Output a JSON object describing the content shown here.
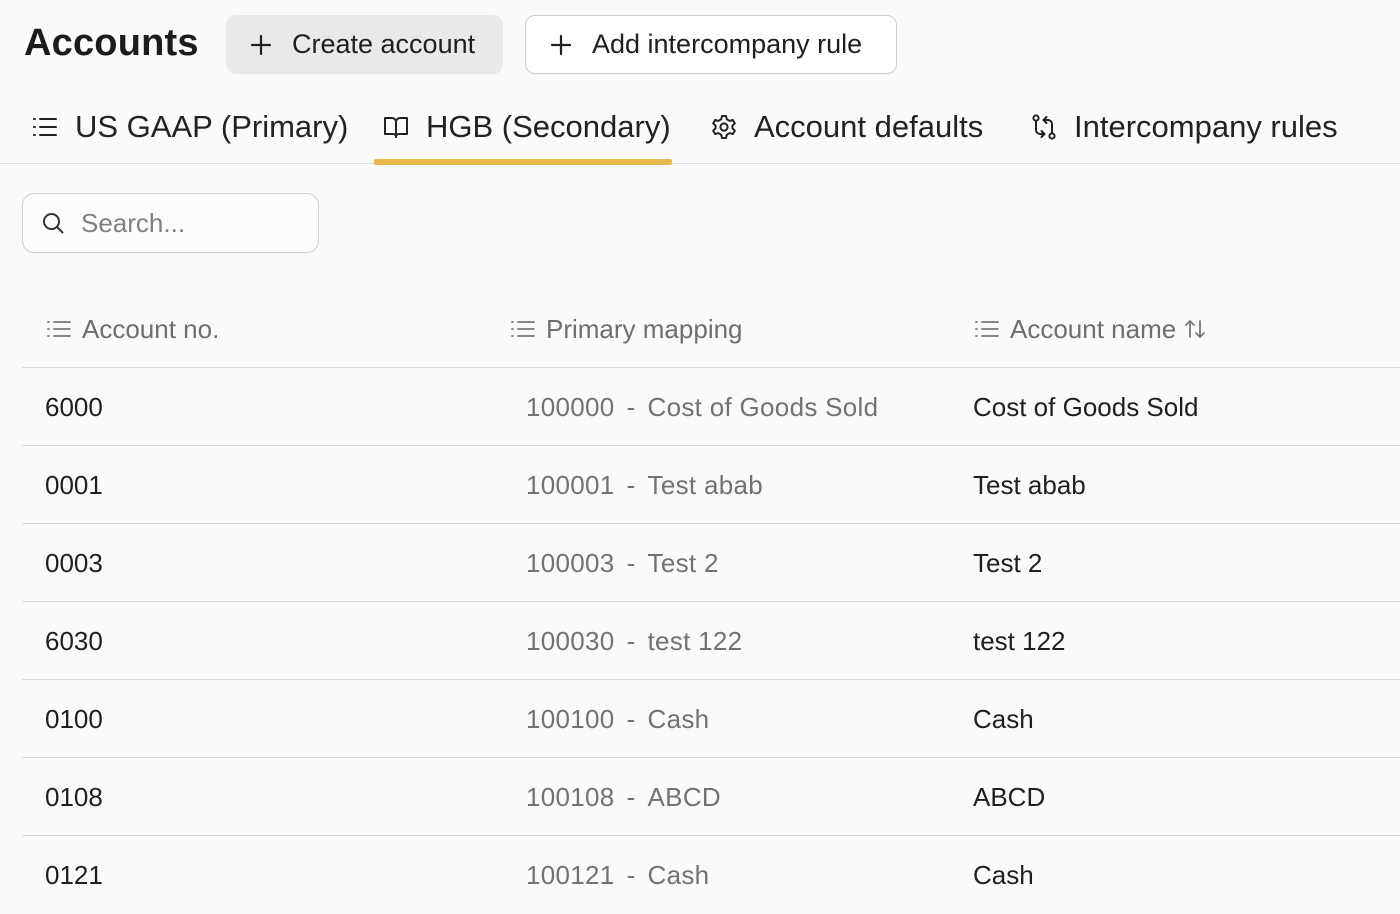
{
  "header": {
    "title": "Accounts",
    "create_label": "Create account",
    "intercompany_label": "Add intercompany rule"
  },
  "tabs": [
    {
      "label": "US GAAP (Primary)",
      "icon": "list-icon",
      "active": false
    },
    {
      "label": "HGB (Secondary)",
      "icon": "book-icon",
      "active": true
    },
    {
      "label": "Account defaults",
      "icon": "gear-icon",
      "active": false
    },
    {
      "label": "Intercompany rules",
      "icon": "swap-icon",
      "active": false
    }
  ],
  "search": {
    "placeholder": "Search..."
  },
  "table": {
    "columns": [
      {
        "label": "Account no."
      },
      {
        "label": "Primary mapping"
      },
      {
        "label": "Account name",
        "sortable": true
      }
    ],
    "rows": [
      {
        "account_no": "6000",
        "mapping_no": "100000",
        "mapping_name": "Cost of Goods Sold",
        "name": "Cost of Goods Sold"
      },
      {
        "account_no": "0001",
        "mapping_no": "100001",
        "mapping_name": "Test abab",
        "name": "Test abab"
      },
      {
        "account_no": "0003",
        "mapping_no": "100003",
        "mapping_name": "Test 2",
        "name": "Test 2"
      },
      {
        "account_no": "6030",
        "mapping_no": "100030",
        "mapping_name": "test 122",
        "name": "test 122"
      },
      {
        "account_no": "0100",
        "mapping_no": "100100",
        "mapping_name": "Cash",
        "name": "Cash"
      },
      {
        "account_no": "0108",
        "mapping_no": "100108",
        "mapping_name": "ABCD",
        "name": "ABCD"
      },
      {
        "account_no": "0121",
        "mapping_no": "100121",
        "mapping_name": "Cash",
        "name": "Cash"
      }
    ],
    "separator": "-"
  },
  "colors": {
    "accent": "#e8b84a",
    "background": "#fafafa"
  }
}
